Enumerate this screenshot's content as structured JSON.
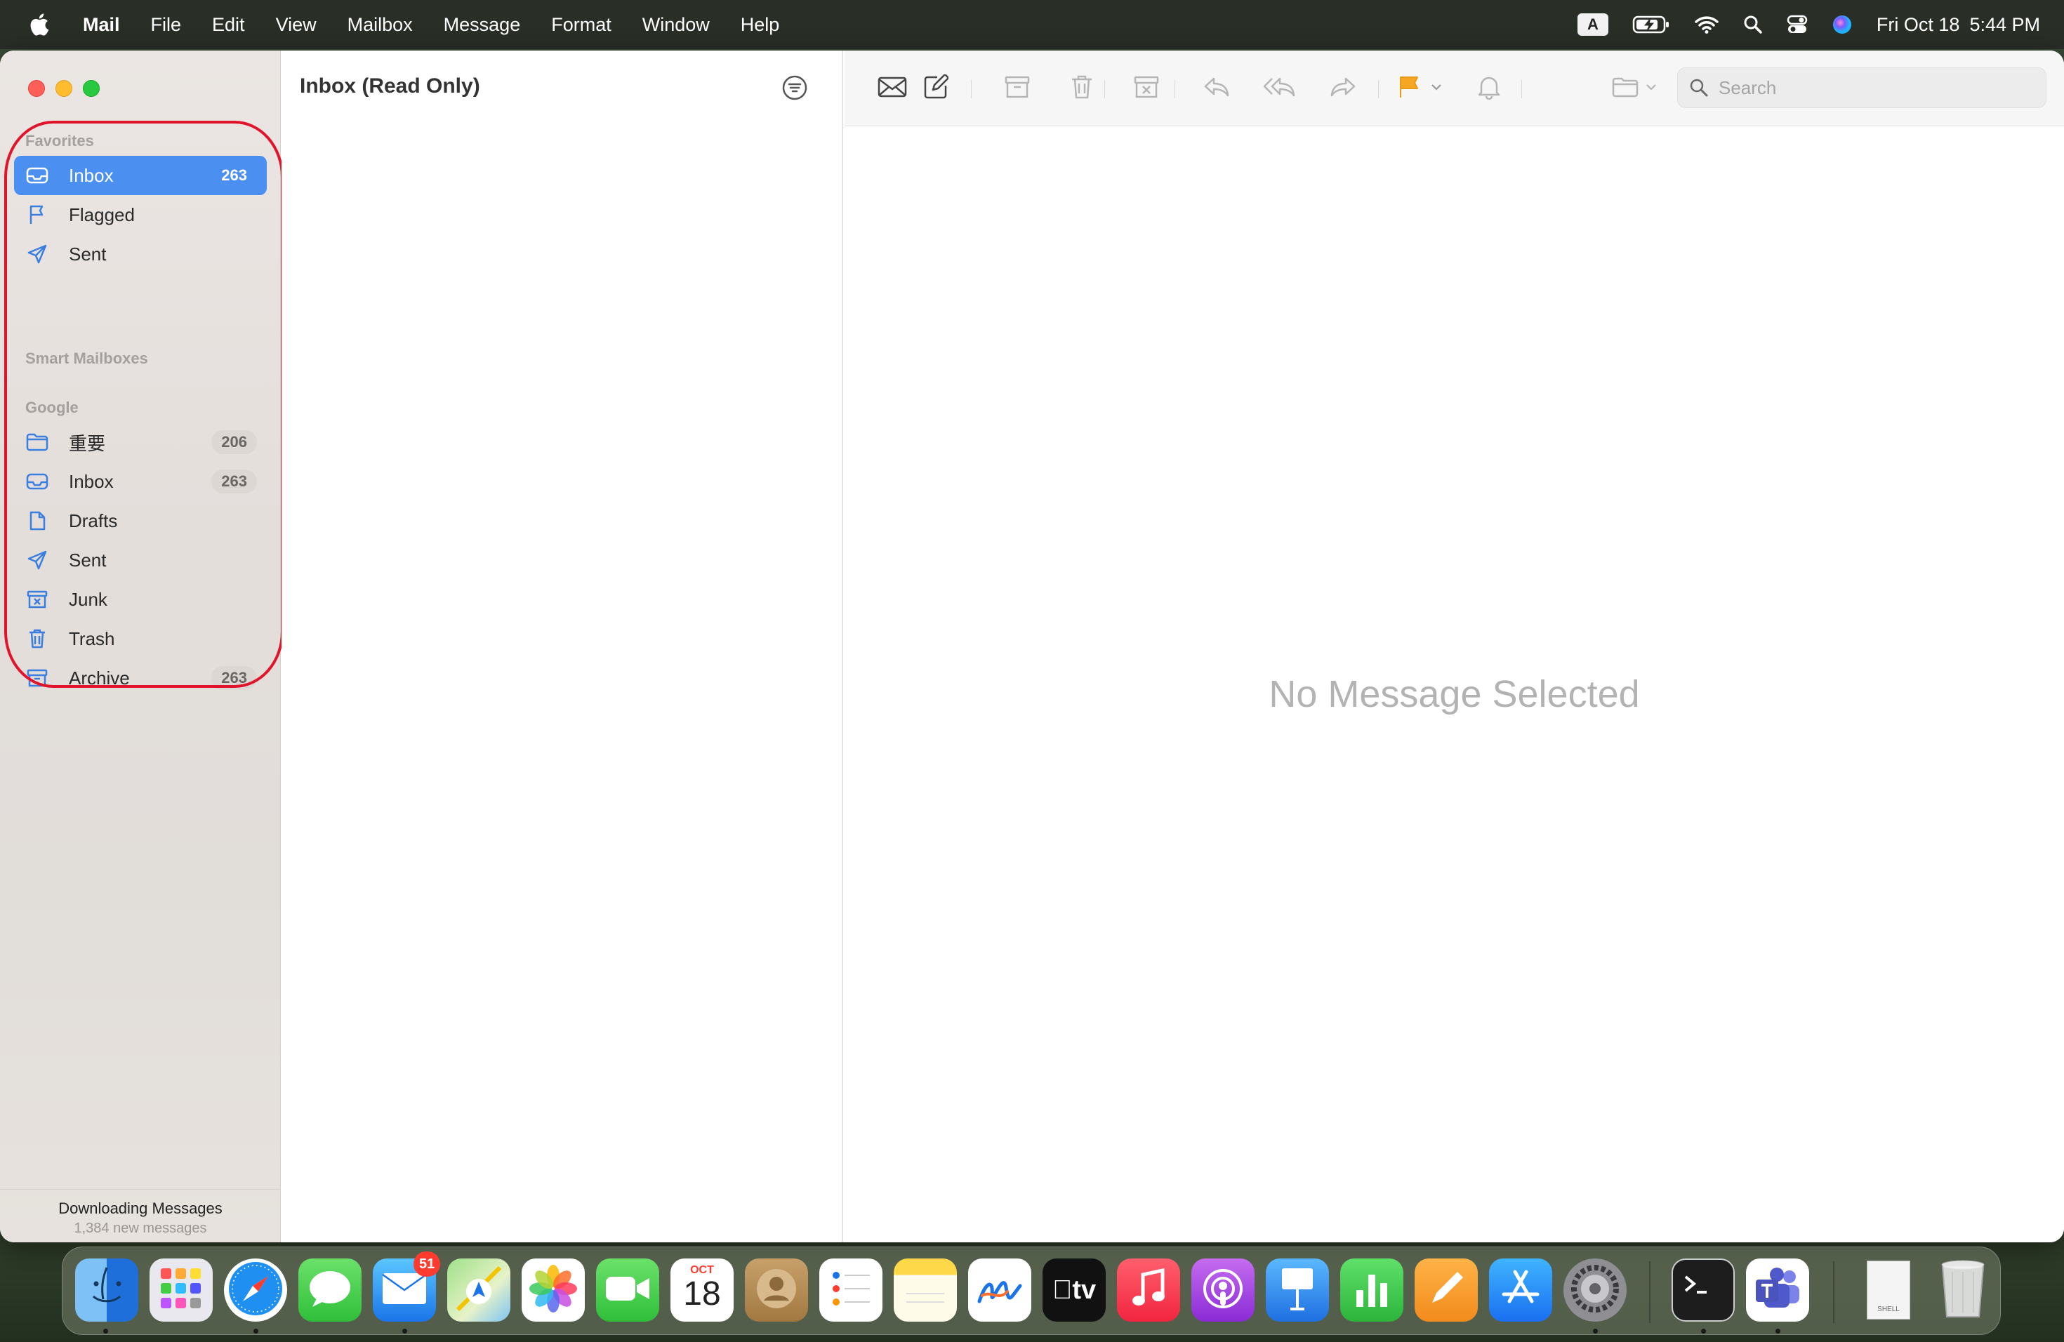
{
  "menubar": {
    "app_name": "Mail",
    "items": [
      "File",
      "Edit",
      "View",
      "Mailbox",
      "Message",
      "Format",
      "Window",
      "Help"
    ],
    "input_source": "A",
    "datetime_date": "Fri Oct 18",
    "datetime_time": "5:44 PM"
  },
  "sidebar": {
    "favorites_header": "Favorites",
    "smart_header": "Smart Mailboxes",
    "google_header": "Google",
    "favorites": [
      {
        "label": "Inbox",
        "count": "263",
        "icon": "inbox-icon",
        "selected": true
      },
      {
        "label": "Flagged",
        "count": "",
        "icon": "flag-icon"
      },
      {
        "label": "Sent",
        "count": "",
        "icon": "paperplane-icon"
      }
    ],
    "google": [
      {
        "label": "重要",
        "count": "206",
        "icon": "folder-icon"
      },
      {
        "label": "Inbox",
        "count": "263",
        "icon": "inbox-icon"
      },
      {
        "label": "Drafts",
        "count": "",
        "icon": "document-icon"
      },
      {
        "label": "Sent",
        "count": "",
        "icon": "paperplane-icon"
      },
      {
        "label": "Junk",
        "count": "",
        "icon": "junk-icon"
      },
      {
        "label": "Trash",
        "count": "",
        "icon": "trash-icon"
      },
      {
        "label": "Archive",
        "count": "263",
        "icon": "archive-icon"
      }
    ],
    "status_line1": "Downloading Messages",
    "status_line2": "1,384 new messages"
  },
  "message_list": {
    "title": "Inbox (Read Only)"
  },
  "viewer": {
    "search_placeholder": "Search",
    "empty_text": "No Message Selected"
  },
  "colors": {
    "accent": "#4b8ff0",
    "highlight_ring": "#e0142a",
    "flag": "#f6a623"
  },
  "dock": {
    "apps": [
      "Finder",
      "Launchpad",
      "Safari",
      "Messages",
      "Mail",
      "Maps",
      "Photos",
      "FaceTime",
      "Calendar",
      "Contacts",
      "Reminders",
      "Notes",
      "Freeform",
      "TV",
      "Music",
      "Podcasts",
      "Keynote",
      "Numbers",
      "Pages",
      "App Store",
      "System Settings",
      "Terminal",
      "Teams",
      "Shell Document",
      "Trash"
    ],
    "mail_badge": "51",
    "calendar_month": "OCT",
    "calendar_day": "18",
    "tv_label": "tv",
    "shell_label": "SHELL"
  }
}
